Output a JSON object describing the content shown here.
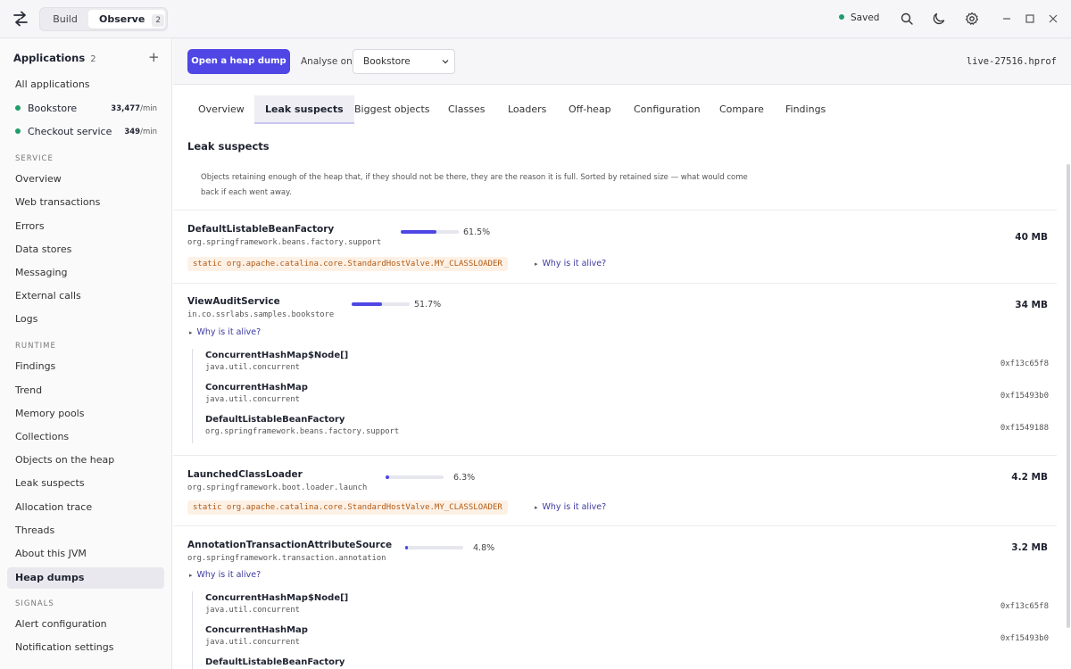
{
  "topbar": {
    "modes": {
      "build": "Build",
      "observe": "Observe",
      "observe_badge": "2"
    },
    "saved_label": "Saved",
    "icons": [
      "search-icon",
      "moon-icon",
      "gear-icon",
      "minimize-icon",
      "maximize-icon",
      "close-icon"
    ]
  },
  "sidebar": {
    "applications_title": "Applications",
    "applications_count": "2",
    "all_applications": "All applications",
    "apps": [
      {
        "name": "Bookstore",
        "rate": "33,477",
        "unit": "/min"
      },
      {
        "name": "Checkout service",
        "rate": "349",
        "unit": "/min"
      }
    ],
    "sections": {
      "service": "SERVICE",
      "runtime": "RUNTIME",
      "signals": "SIGNALS"
    },
    "service_items": [
      "Overview",
      "Web transactions",
      "Errors",
      "Data stores",
      "Messaging",
      "External calls",
      "Logs"
    ],
    "runtime_items": [
      "Findings",
      "Trend",
      "Memory pools",
      "Collections",
      "Objects on the heap",
      "Leak suspects",
      "Allocation trace",
      "Threads",
      "About this JVM",
      "Heap dumps"
    ],
    "signals_items": [
      "Alert configuration",
      "Notification settings"
    ],
    "active_item": "Heap dumps"
  },
  "toolbar": {
    "open_button": "Open a heap dump",
    "analyse_label": "Analyse on",
    "analyse_value": "Bookstore",
    "filename": "live-27516.hprof"
  },
  "tabs": [
    "Overview",
    "Leak suspects",
    "Biggest objects",
    "Classes",
    "Loaders",
    "Off-heap",
    "Configuration",
    "Compare",
    "Findings"
  ],
  "active_tab": "Leak suspects",
  "content": {
    "title": "Leak suspects",
    "description": "Objects retaining enough of the heap that, if they should not be there, they are the reason it is full. Sorted by retained size — what would come back if each went away.",
    "why_label": "Why is it alive?",
    "suspects": [
      {
        "name": "DefaultListableBeanFactory",
        "package": "org.springframework.beans.factory.support",
        "percent": "61.5%",
        "fraction": 0.615,
        "size": "40 MB",
        "static_root": "static org.apache.catalina.core.StandardHostValve.MY_CLASSLOADER"
      },
      {
        "name": "ViewAuditService",
        "package": "in.co.ssrlabs.samples.bookstore",
        "percent": "51.7%",
        "fraction": 0.517,
        "size": "34 MB",
        "chain": [
          {
            "name": "ConcurrentHashMap$Node[]",
            "package": "java.util.concurrent",
            "address": "0xf13c65f8"
          },
          {
            "name": "ConcurrentHashMap",
            "package": "java.util.concurrent",
            "address": "0xf15493b0"
          },
          {
            "name": "DefaultListableBeanFactory",
            "package": "org.springframework.beans.factory.support",
            "address": "0xf1549188"
          }
        ]
      },
      {
        "name": "LaunchedClassLoader",
        "package": "org.springframework.boot.loader.launch",
        "percent": "6.3%",
        "fraction": 0.063,
        "size": "4.2 MB",
        "static_root": "static org.apache.catalina.core.StandardHostValve.MY_CLASSLOADER"
      },
      {
        "name": "AnnotationTransactionAttributeSource",
        "package": "org.springframework.transaction.annotation",
        "percent": "4.8%",
        "fraction": 0.048,
        "size": "3.2 MB",
        "chain": [
          {
            "name": "ConcurrentHashMap$Node[]",
            "package": "java.util.concurrent",
            "address": "0xf13c65f8"
          },
          {
            "name": "ConcurrentHashMap",
            "package": "java.util.concurrent",
            "address": "0xf15493b0"
          },
          {
            "name": "DefaultListableBeanFactory",
            "package": "",
            "address": ""
          }
        ]
      }
    ]
  }
}
